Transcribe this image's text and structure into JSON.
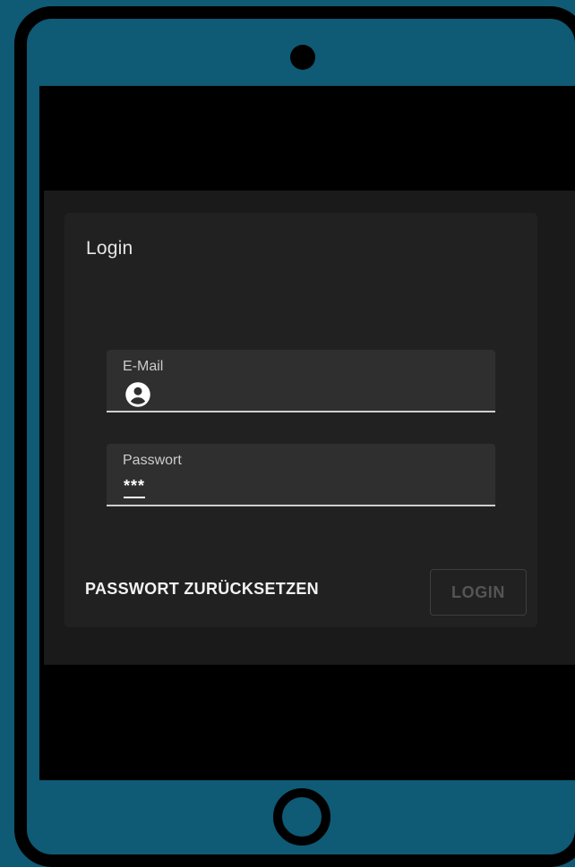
{
  "login": {
    "title": "Login",
    "email": {
      "label": "E-Mail",
      "icon": "account-circle-icon"
    },
    "password": {
      "label": "Passwort",
      "mask": "***"
    },
    "reset_label": "PASSWORT ZURÜCKSETZEN",
    "login_label": "LOGIN"
  },
  "colors": {
    "outer_background": "#0f5a75",
    "device_frame": "#000000",
    "card": "#212121",
    "field": "#2f2f2f",
    "text_primary": "#f2f2f2",
    "disabled_button": "#555555"
  }
}
